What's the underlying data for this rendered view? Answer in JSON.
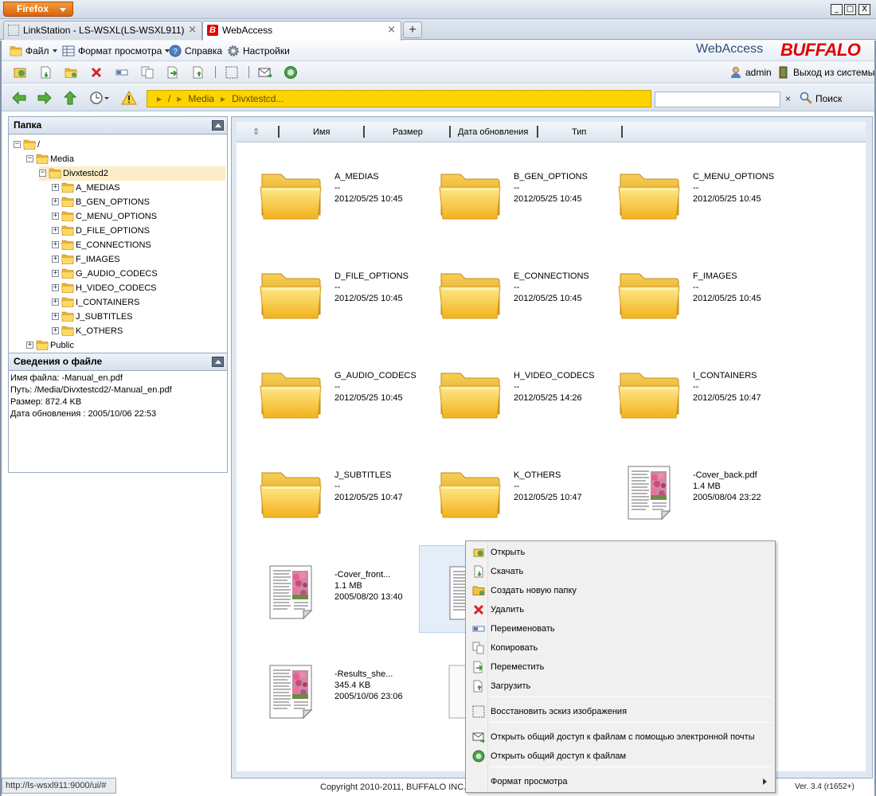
{
  "browser": {
    "menu_button": "Firefox",
    "window_controls": {
      "minimize": "_",
      "maximize": "□",
      "close": "X"
    },
    "tabs": [
      {
        "label": "LinkStation - LS-WSXL(LS-WSXL911)",
        "close": "×"
      },
      {
        "label": "WebAccess",
        "close": "×"
      }
    ],
    "new_tab": "+",
    "status_url": "http://ls-wsxl911:9000/ui/#"
  },
  "menubar": {
    "file": "Файл",
    "view_format": "Формат просмотра",
    "help": "Справка",
    "settings": "Настройки",
    "brand_text": "WebAccess",
    "brand_logo": "BUFFALO"
  },
  "toolbar": {
    "user": "admin",
    "logout": "Выход из системы"
  },
  "navbar": {
    "path": [
      "/",
      "Media",
      "Divxtestcd..."
    ],
    "search_placeholder": "",
    "search_clear": "×",
    "search_button": "Поиск"
  },
  "folder_panel": {
    "title": "Папка",
    "tree": [
      {
        "label": "/",
        "toggle": "−",
        "level": 0
      },
      {
        "label": "Media",
        "toggle": "−",
        "level": 1
      },
      {
        "label": "Divxtestcd2",
        "toggle": "−",
        "level": 2,
        "selected": true
      },
      {
        "label": "A_MEDIAS",
        "toggle": "+",
        "level": 3
      },
      {
        "label": "B_GEN_OPTIONS",
        "toggle": "+",
        "level": 3
      },
      {
        "label": "C_MENU_OPTIONS",
        "toggle": "+",
        "level": 3
      },
      {
        "label": "D_FILE_OPTIONS",
        "toggle": "+",
        "level": 3
      },
      {
        "label": "E_CONNECTIONS",
        "toggle": "+",
        "level": 3
      },
      {
        "label": "F_IMAGES",
        "toggle": "+",
        "level": 3
      },
      {
        "label": "G_AUDIO_CODECS",
        "toggle": "+",
        "level": 3
      },
      {
        "label": "H_VIDEO_CODECS",
        "toggle": "+",
        "level": 3
      },
      {
        "label": "I_CONTAINERS",
        "toggle": "+",
        "level": 3
      },
      {
        "label": "J_SUBTITLES",
        "toggle": "+",
        "level": 3
      },
      {
        "label": "K_OTHERS",
        "toggle": "+",
        "level": 3
      },
      {
        "label": "Public",
        "toggle": "+",
        "level": 1
      }
    ]
  },
  "info_panel": {
    "title": "Сведения о файле",
    "lines": [
      "Имя файла: -Manual_en.pdf",
      "Путь: /Media/Divxtestcd2/-Manual_en.pdf",
      "Размер: 872.4 KB",
      "Дата обновления : 2005/10/06 22:53"
    ]
  },
  "columns": {
    "sort_icon": "⇕",
    "name": "Имя",
    "size": "Размер",
    "updated": "Дата обновления",
    "type": "Тип"
  },
  "items": [
    {
      "name": "A_MEDIAS",
      "size": "--",
      "date": "2012/05/25 10:45",
      "kind": "folder"
    },
    {
      "name": "B_GEN_OPTIONS",
      "size": "--",
      "date": "2012/05/25 10:45",
      "kind": "folder"
    },
    {
      "name": "C_MENU_OPTIONS",
      "size": "--",
      "date": "2012/05/25 10:45",
      "kind": "folder"
    },
    {
      "name": "D_FILE_OPTIONS",
      "size": "--",
      "date": "2012/05/25 10:45",
      "kind": "folder"
    },
    {
      "name": "E_CONNECTIONS",
      "size": "--",
      "date": "2012/05/25 10:45",
      "kind": "folder"
    },
    {
      "name": "F_IMAGES",
      "size": "--",
      "date": "2012/05/25 10:45",
      "kind": "folder"
    },
    {
      "name": "G_AUDIO_CODECS",
      "size": "--",
      "date": "2012/05/25 10:45",
      "kind": "folder"
    },
    {
      "name": "H_VIDEO_CODECS",
      "size": "--",
      "date": "2012/05/25 14:26",
      "kind": "folder"
    },
    {
      "name": "I_CONTAINERS",
      "size": "--",
      "date": "2012/05/25 10:47",
      "kind": "folder"
    },
    {
      "name": "J_SUBTITLES",
      "size": "--",
      "date": "2012/05/25 10:47",
      "kind": "folder"
    },
    {
      "name": "K_OTHERS",
      "size": "--",
      "date": "2012/05/25 10:47",
      "kind": "folder"
    },
    {
      "name": "-Cover_back.pdf",
      "size": "1.4 MB",
      "date": "2005/08/04 23:22",
      "kind": "pdf"
    },
    {
      "name": "-Cover_front...",
      "size": "1.1 MB",
      "date": "2005/08/20 13:40",
      "kind": "pdf"
    },
    {
      "name": "",
      "size": "",
      "date": "",
      "kind": "pdf",
      "selected": true
    },
    {
      "name": "",
      "size": "",
      "date": "",
      "kind": "blank"
    },
    {
      "name": "-Results_she...",
      "size": "345.4 KB",
      "date": "2005/10/06 23:06",
      "kind": "pdf"
    },
    {
      "name": "",
      "size": "",
      "date": "",
      "kind": "blank"
    }
  ],
  "context_menu": {
    "items": [
      {
        "label": "Открыть",
        "icon": "open-icon"
      },
      {
        "label": "Скачать",
        "icon": "download-icon"
      },
      {
        "label": "Создать новую папку",
        "icon": "new-folder-icon"
      },
      {
        "label": "Удалить",
        "icon": "delete-icon"
      },
      {
        "label": "Переименовать",
        "icon": "rename-icon"
      },
      {
        "label": "Копировать",
        "icon": "copy-icon"
      },
      {
        "label": "Переместить",
        "icon": "move-icon"
      },
      {
        "label": "Загрузить",
        "icon": "upload-icon"
      },
      {
        "label": "Восстановить эскиз изображения",
        "icon": "thumbnail-icon"
      },
      {
        "label": "Открыть общий доступ к файлам с помощью электронной почты",
        "icon": "email-share-icon"
      },
      {
        "label": "Открыть общий доступ к файлам",
        "icon": "share-icon"
      },
      {
        "label": "Формат просмотра",
        "icon": "view-format-icon"
      }
    ]
  },
  "footer": {
    "copyright": "Copyright 2010-2011, BUFFALO INC.",
    "version": "Ver. 3.4 (r1652+)"
  },
  "colors": {
    "path_bar": "#fdd300",
    "brand_red": "#e00000",
    "firefox_orange": "#e8791c",
    "panel_border": "#99a9bd"
  }
}
